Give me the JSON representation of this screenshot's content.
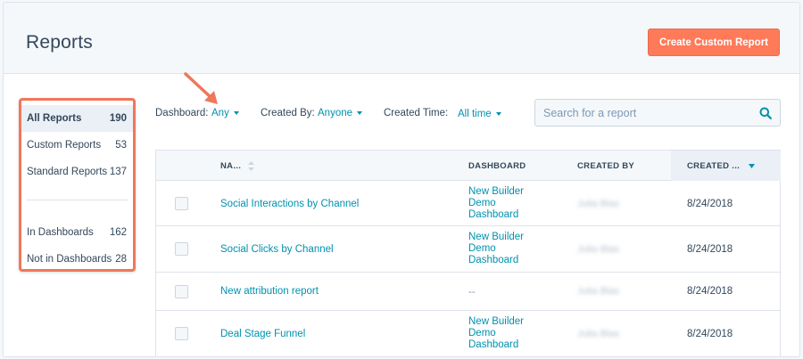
{
  "header": {
    "title": "Reports",
    "create_button": "Create Custom Report"
  },
  "sidebar": {
    "items": [
      {
        "label": "All Reports",
        "count": "190",
        "active": true
      },
      {
        "label": "Custom Reports",
        "count": "53"
      },
      {
        "label": "Standard Reports",
        "count": "137"
      },
      {
        "label": "In Dashboards",
        "count": "162"
      },
      {
        "label": "Not in Dashboards",
        "count": "28"
      }
    ]
  },
  "filters": {
    "dashboard_label": "Dashboard:",
    "dashboard_value": "Any",
    "created_by_label": "Created By:",
    "created_by_value": "Anyone",
    "created_time_label": "Created Time:",
    "created_time_value": "All time"
  },
  "search": {
    "placeholder": "Search for a report"
  },
  "table": {
    "columns": [
      "NA...",
      "DASHBOARD",
      "CREATED BY",
      "CREATED ..."
    ],
    "rows": [
      {
        "name": "Social Interactions by Channel",
        "dashboard": [
          "New Builder",
          "Demo",
          "Dashboard"
        ],
        "created_by": "Julia Blas",
        "created": "8/24/2018"
      },
      {
        "name": "Social Clicks by Channel",
        "dashboard": [
          "New Builder",
          "Demo",
          "Dashboard"
        ],
        "created_by": "Julia Blas",
        "created": "8/24/2018"
      },
      {
        "name": "New attribution report",
        "dashboard": [
          "--"
        ],
        "created_by": "Julia Blas",
        "created": "8/24/2018"
      },
      {
        "name": "Deal Stage Funnel",
        "dashboard": [
          "New Builder",
          "Demo",
          "Dashboard"
        ],
        "created_by": "Julia Blas",
        "created": "8/24/2018"
      }
    ]
  },
  "colors": {
    "accent_orange": "#ff7a59",
    "link_teal": "#0091ae",
    "text_dark": "#33475b",
    "highlight_border": "#f0775a"
  },
  "icons": {
    "search": "search-icon",
    "sort": "sort-icon",
    "sort_desc": "sort-desc-icon",
    "annotation_arrow": "annotation-arrow-icon",
    "caret": "caret-down-icon"
  }
}
